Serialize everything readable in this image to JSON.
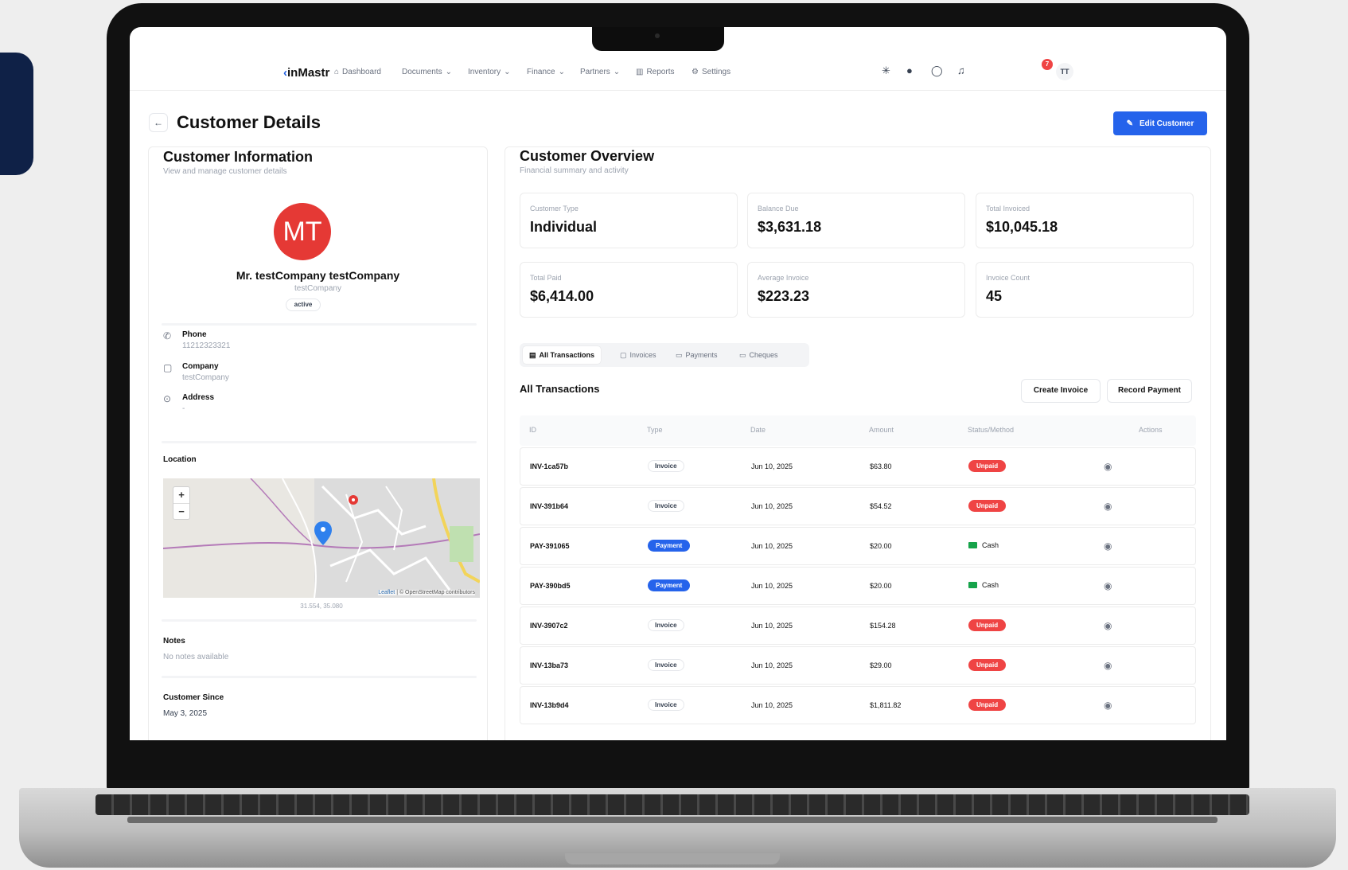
{
  "nav": {
    "logo": "inMastr",
    "items": [
      "Dashboard",
      "Documents",
      "Inventory",
      "Finance",
      "Partners",
      "Reports",
      "Settings"
    ],
    "notification_count": "7",
    "user_initials": "TT"
  },
  "header": {
    "back": "←",
    "title": "Customer Details",
    "edit_button": "Edit Customer"
  },
  "customer": {
    "section_title": "Customer Information",
    "section_subtitle": "View and manage customer details",
    "initials": "MT",
    "name": "Mr. testCompany testCompany",
    "company": "testCompany",
    "status": "active",
    "phone_label": "Phone",
    "phone": "11212323321",
    "company_label": "Company",
    "company_value": "testCompany",
    "address_label": "Address",
    "address": "-",
    "location_label": "Location",
    "coords": "31.554, 35.080",
    "map_attribution_leaflet": "Leaflet",
    "map_attribution_rest": " | © OpenStreetMap contributors",
    "notes_label": "Notes",
    "notes": "No notes available",
    "since_label": "Customer Since",
    "since": "May 3, 2025"
  },
  "overview": {
    "title": "Customer Overview",
    "subtitle": "Financial summary and activity",
    "stats": [
      {
        "label": "Customer Type",
        "value": "Individual"
      },
      {
        "label": "Balance Due",
        "value": "$3,631.18"
      },
      {
        "label": "Total Invoiced",
        "value": "$10,045.18"
      },
      {
        "label": "Total Paid",
        "value": "$6,414.00"
      },
      {
        "label": "Average Invoice",
        "value": "$223.23"
      },
      {
        "label": "Invoice Count",
        "value": "45"
      }
    ]
  },
  "tabs": [
    "All Transactions",
    "Invoices",
    "Payments",
    "Cheques"
  ],
  "transactions": {
    "title": "All Transactions",
    "create_invoice": "Create Invoice",
    "record_payment": "Record Payment",
    "columns": [
      "ID",
      "Type",
      "Date",
      "Amount",
      "Status/Method",
      "Actions"
    ],
    "rows": [
      {
        "id": "INV-1ca57b",
        "type": "Invoice",
        "date": "Jun 10, 2025",
        "amount": "$63.80",
        "status": "Unpaid"
      },
      {
        "id": "INV-391b64",
        "type": "Invoice",
        "date": "Jun 10, 2025",
        "amount": "$54.52",
        "status": "Unpaid"
      },
      {
        "id": "PAY-391065",
        "type": "Payment",
        "date": "Jun 10, 2025",
        "amount": "$20.00",
        "status": "Cash"
      },
      {
        "id": "PAY-390bd5",
        "type": "Payment",
        "date": "Jun 10, 2025",
        "amount": "$20.00",
        "status": "Cash"
      },
      {
        "id": "INV-3907c2",
        "type": "Invoice",
        "date": "Jun 10, 2025",
        "amount": "$154.28",
        "status": "Unpaid"
      },
      {
        "id": "INV-13ba73",
        "type": "Invoice",
        "date": "Jun 10, 2025",
        "amount": "$29.00",
        "status": "Unpaid"
      },
      {
        "id": "INV-13b9d4",
        "type": "Invoice",
        "date": "Jun 10, 2025",
        "amount": "$1,811.82",
        "status": "Unpaid"
      }
    ]
  },
  "colors": {
    "primary": "#2563eb",
    "avatar": "#e53935",
    "unpaid": "#ef4444",
    "cash": "#16a34a",
    "brand_tab": "#0f2147"
  }
}
